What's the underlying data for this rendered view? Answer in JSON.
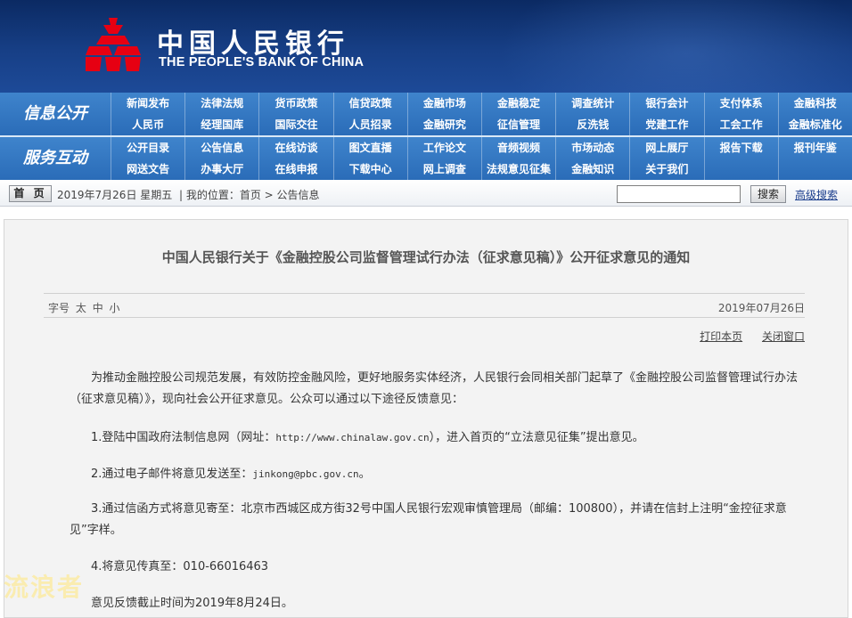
{
  "header": {
    "title_cn": "中国人民银行",
    "title_en": "THE PEOPLE'S BANK OF CHINA",
    "colors": {
      "bg": "#173f86",
      "nav": "#2a6cb8"
    }
  },
  "nav": {
    "band1_label": "信息公开",
    "band1_row1": [
      "新闻发布",
      "法律法规",
      "货币政策",
      "信贷政策",
      "金融市场",
      "金融稳定",
      "调查统计",
      "银行会计",
      "支付体系",
      "金融科技"
    ],
    "band1_row2": [
      "人民币",
      "经理国库",
      "国际交往",
      "人员招录",
      "金融研究",
      "征信管理",
      "反洗钱",
      "党建工作",
      "工会工作",
      "金融标准化"
    ],
    "band2_label": "服务互动",
    "band2_row1": [
      "公开目录",
      "公告信息",
      "在线访谈",
      "图文直播",
      "工作论文",
      "音频视频",
      "市场动态",
      "网上展厅",
      "报告下载",
      "报刊年鉴"
    ],
    "band2_row2": [
      "网送文告",
      "办事大厅",
      "在线申报",
      "下载中心",
      "网上调查",
      "法规意见征集",
      "金融知识",
      "关于我们",
      "",
      ""
    ]
  },
  "toolbar": {
    "home_label": "首 页",
    "date": "2019年7月26日 星期五",
    "location": "| 我的位置：首页 > 公告信息",
    "search_value": "",
    "search_label": "搜索",
    "advanced_search": "高级搜索"
  },
  "article": {
    "title": "中国人民银行关于《金融控股公司监督管理试行办法（征求意见稿）》公开征求意见的通知",
    "font_size_label": "字号",
    "font_sizes": [
      "太",
      "中",
      "小"
    ],
    "pub_date": "2019年07月26日",
    "print_label": "打印本页",
    "close_label": "关闭窗口",
    "intro": "为推动金融控股公司规范发展，有效防控金融风险，更好地服务实体经济，人民银行会同相关部门起草了《金融控股公司监督管理试行办法（征求意见稿）》，现向社会公开征求意见。公众可以通过以下途径反馈意见：",
    "item1_pre": "1.登陆中国政府法制信息网（网址：",
    "item1_url": "http://www.chinalaw.gov.cn",
    "item1_post": "），进入首页的“立法意见征集”提出意见。",
    "item2_pre": "2.通过电子邮件将意见发送至：",
    "item2_email": "jinkong@pbc.gov.cn",
    "item2_post": "。",
    "item3": "3.通过信函方式将意见寄至：北京市西城区成方街32号中国人民银行宏观审慎管理局（邮编：100800），并请在信封上注明“金控征求意见”字样。",
    "item4": "4.将意见传真至：010-66016463",
    "deadline": "意见反馈截止时间为2019年8月24日。"
  },
  "watermark": "流浪者"
}
